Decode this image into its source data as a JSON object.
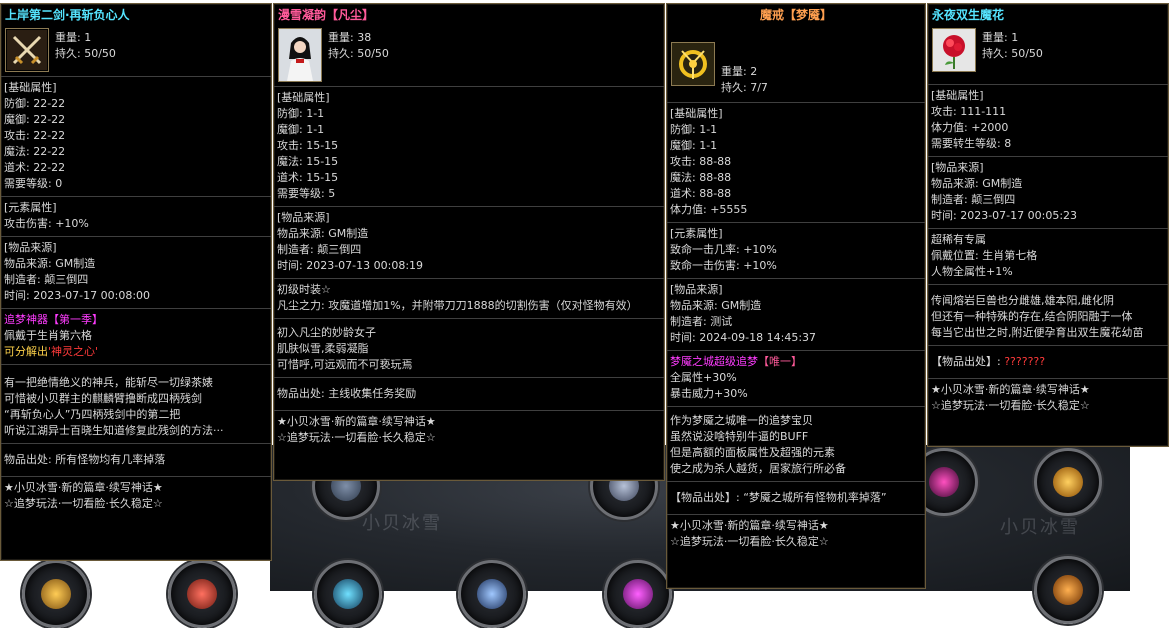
{
  "tooltip1": {
    "title": "上岸第二剑·再斩负心人",
    "weight": "重量: 1",
    "durability": "持久: 50/50",
    "base_header": "[基础属性]",
    "base": [
      "防御: 22-22",
      "魔御: 22-22",
      "攻击: 22-22",
      "魔法: 22-22",
      "道术: 22-22",
      "需要等级: 0"
    ],
    "element_header": "[元素属性]",
    "element": [
      "攻击伤害: +10%"
    ],
    "source_header": "[物品来源]",
    "source": [
      "物品来源: GM制造",
      "制造者: 颠三倒四",
      "时间: 2023-07-17 00:08:00"
    ],
    "set_title_a": "追梦神器",
    "set_title_b": "【第一季】",
    "set_line1": "佩戴于生肖第六格",
    "set_line2_a": "可分解出",
    "set_line2_b": "'神灵之心'",
    "lore": [
      "有一把绝情绝义的神兵，能斩尽一切绿茶婊",
      "可惜被小贝群主的麒麟臂撸断成四柄残剑",
      "“再斩负心人”乃四柄残剑中的第二把",
      "听说江湖异士百晓生知道修复此残剑的方法···"
    ],
    "drop": "物品出处: 所有怪物均有几率掉落",
    "footer1": "★小贝冰雪·新的篇章·续写神话★",
    "footer2": "☆追梦玩法·一切看脸·长久稳定☆"
  },
  "tooltip2": {
    "title": "漫雪凝韵【凡尘】",
    "weight": "重量: 38",
    "durability": "持久: 50/50",
    "base_header": "[基础属性]",
    "base": [
      "防御: 1-1",
      "魔御: 1-1",
      "攻击: 15-15",
      "魔法: 15-15",
      "道术: 15-15",
      "需要等级: 5"
    ],
    "source_header": "[物品来源]",
    "source": [
      "物品来源: GM制造",
      "制造者: 颠三倒四",
      "时间: 2023-07-13 00:08:19"
    ],
    "special_title": "初级时装☆",
    "special_line": "凡尘之力: 攻魔道增加1%，并附带刀刀1888的切割伤害（仅对怪物有效）",
    "lore": [
      "初入凡尘的妙龄女子",
      "肌肤似雪,柔弱凝脂",
      "可惜呼,可远观而不可亵玩焉"
    ],
    "drop": "物品出处: 主线收集任务奖励",
    "footer1": "★小贝冰雪·新的篇章·续写神话★",
    "footer2": "☆追梦玩法·一切看脸·长久稳定☆"
  },
  "tooltip3": {
    "title": "魔戒【梦魇】",
    "weight": "重量: 2",
    "durability": "持久: 7/7",
    "base_header": "[基础属性]",
    "base": [
      "防御: 1-1",
      "魔御: 1-1",
      "攻击: 88-88",
      "魔法: 88-88",
      "道术: 88-88",
      "体力值: +5555"
    ],
    "element_header": "[元素属性]",
    "element": [
      "致命一击几率: +10%",
      "致命一击伤害: +10%"
    ],
    "source_header": "[物品来源]",
    "source": [
      "物品来源: GM制造",
      "制造者: 测试",
      "时间: 2024-09-18 14:45:37"
    ],
    "set_title_a": "梦魇之城超级追梦",
    "set_title_b": "【唯一】",
    "set_line1": "全属性+30%",
    "set_line2": "暴击威力+30%",
    "lore": [
      "作为梦魇之城唯一的追梦宝贝",
      "虽然说没啥特别牛逼的BUFF",
      "但是高额的面板属性及超强的元素",
      "使之成为杀人越货，居家旅行所必备"
    ],
    "drop": "【物品出处】: “梦魇之城所有怪物机率掉落”",
    "footer1": "★小贝冰雪·新的篇章·续写神话★",
    "footer2": "☆追梦玩法·一切看脸·长久稳定☆"
  },
  "tooltip4": {
    "title": "永夜双生魔花",
    "weight": "重量: 1",
    "durability": "持久: 50/50",
    "base_header": "[基础属性]",
    "base": [
      "攻击: 111-111",
      "体力值: +2000",
      "需要转生等级: 8"
    ],
    "source_header": "[物品来源]",
    "source": [
      "物品来源: GM制造",
      "制造者: 颠三倒四",
      "时间: 2023-07-17 00:05:23"
    ],
    "special_title": "超稀有专属",
    "special_line1": "佩戴位置: 生肖第七格",
    "special_line2": "人物全属性+1%",
    "lore": [
      "传闻熔岩巨兽也分雌雄,雄本阳,雌化阴",
      "但还有一种特殊的存在,结合阴阳融于一体",
      "每当它出世之时,附近便孕育出双生魔花幼苗"
    ],
    "drop_label": "【物品出处】:",
    "drop_value": "???????",
    "footer1": "★小贝冰雪·新的篇章·续写神话★",
    "footer2": "☆追梦玩法·一切看脸·长久稳定☆"
  },
  "background": {
    "watermark": "小贝冰雪"
  },
  "colors": {
    "panel_bg": "#000000",
    "panel_border": "#6a5a3a",
    "label_blue": "#4db2ff",
    "title_cyan": "#55e4ff",
    "title_pink": "#ff5a9a",
    "title_orange": "#ffa050"
  }
}
